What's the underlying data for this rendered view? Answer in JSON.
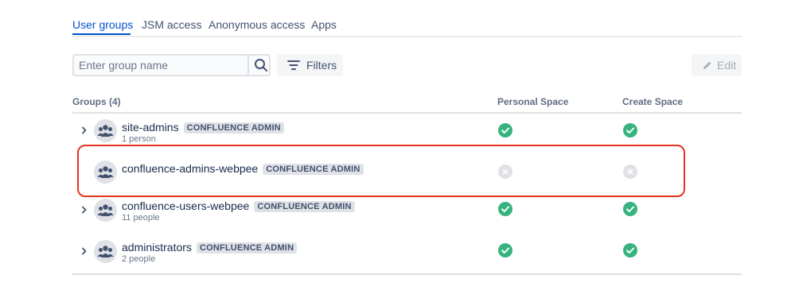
{
  "tabs": [
    {
      "label": "User groups",
      "active": true
    },
    {
      "label": "JSM access",
      "active": false
    },
    {
      "label": "Anonymous access",
      "active": false
    },
    {
      "label": "Apps",
      "active": false
    }
  ],
  "search": {
    "placeholder": "Enter group name",
    "value": ""
  },
  "toolbar": {
    "filters_label": "Filters",
    "edit_label": "Edit"
  },
  "table": {
    "columns": [
      "Groups (4)",
      "Personal Space",
      "Create Space"
    ],
    "rows": [
      {
        "name": "site-admins",
        "badge": "CONFLUENCE ADMIN",
        "members": "1 person",
        "personal_space": "granted",
        "create_space": "granted"
      },
      {
        "name": "confluence-admins-webpee",
        "badge": "CONFLUENCE ADMIN",
        "members": "",
        "personal_space": "denied",
        "create_space": "denied"
      },
      {
        "name": "confluence-users-webpee",
        "badge": "CONFLUENCE ADMIN",
        "members": "11 people",
        "personal_space": "granted",
        "create_space": "granted"
      },
      {
        "name": "administrators",
        "badge": "CONFLUENCE ADMIN",
        "members": "2 people",
        "personal_space": "granted",
        "create_space": "granted"
      }
    ]
  },
  "icons": {
    "search": "search-icon",
    "filters": "filter-icon",
    "edit": "pencil-icon",
    "expand": "chevron-right-icon",
    "group": "people-group-icon",
    "granted": "check-circle-icon",
    "denied": "cross-circle-icon"
  },
  "colors": {
    "accent": "#0052cc",
    "granted": "#36b37e",
    "denied": "#dfe1e6",
    "highlight": "#e5331f"
  }
}
